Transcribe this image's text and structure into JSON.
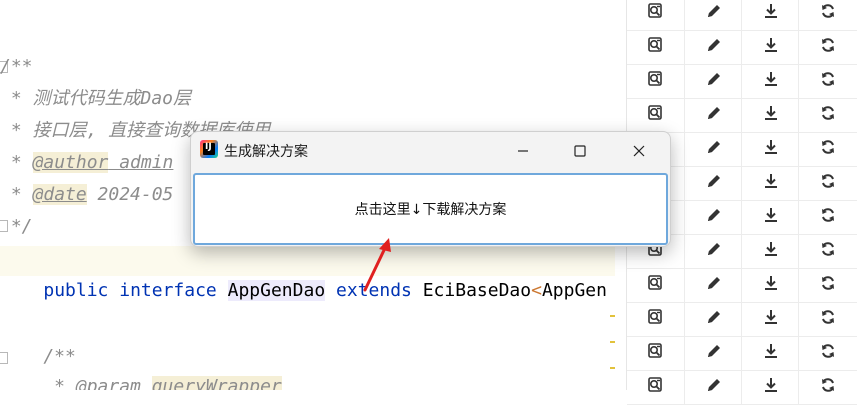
{
  "editor": {
    "comment_open": "/**",
    "comment_line1": " * 测试代码生成Dao层",
    "comment_line2": " * 接口层, 直接查询数据库使用",
    "author_prefix": " * ",
    "author_tag": "@author",
    "author_value": " admin",
    "date_prefix": " * ",
    "date_tag": "@date",
    "date_value": " 2024-05",
    "comment_close": " */",
    "kw_public": "public",
    "kw_interface": "interface",
    "class_name": "AppGenDao",
    "kw_extends": "extends",
    "base_class": "EciBaseDao",
    "angle_open": "<",
    "generic": "AppGen",
    "javadoc_open": "    /**",
    "param_prefix": "     * @param ",
    "param_name": "queryWrapper"
  },
  "actions": {
    "rows": 12,
    "icons": [
      "search-doc-icon",
      "edit-pencil-icon",
      "download-icon",
      "refresh-icon"
    ]
  },
  "dialog": {
    "title": "生成解决方案",
    "link_text": "点击这里↓下载解决方案",
    "minimize_glyph": "—",
    "maximize_glyph": "☐",
    "close_glyph": "✕",
    "app_icon_letter": "IJ"
  },
  "colors": {
    "keyword": "#0033b3",
    "comment": "#8c8c8c",
    "annotation_arrow": "#e02020",
    "focus_border": "#6fa8dc"
  }
}
